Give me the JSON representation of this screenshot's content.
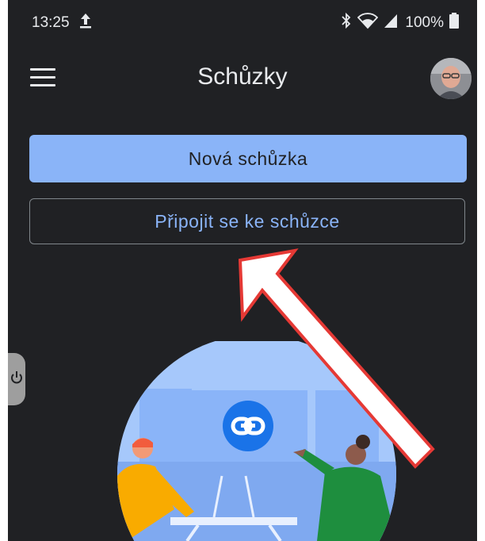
{
  "status_bar": {
    "time": "13:25",
    "battery": "100%",
    "icons": [
      "upload-icon",
      "bluetooth-icon",
      "wifi-icon",
      "signal-icon",
      "battery-icon"
    ]
  },
  "app_bar": {
    "title": "Schůzky",
    "menu_icon": "hamburger-menu-icon",
    "avatar": "user-avatar"
  },
  "actions": {
    "new_meeting": "Nová schůzka",
    "join_meeting": "Připojit se ke schůzce"
  },
  "colors": {
    "background": "#202124",
    "accent": "#8ab4f8",
    "annotation_arrow": "#e53935"
  }
}
